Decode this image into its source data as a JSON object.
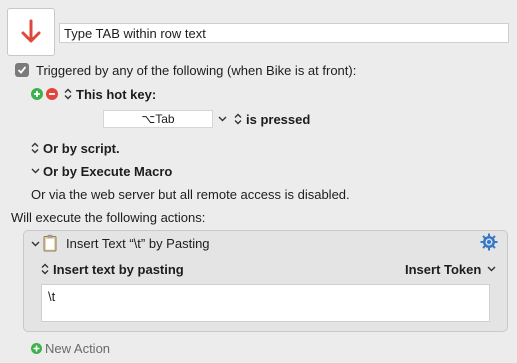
{
  "macro": {
    "name": "Type TAB within row text",
    "icon": "red-down-arrow-icon"
  },
  "trigger": {
    "checked": true,
    "label": "Triggered by any of the following (when Bike is at front):",
    "hotkey_label": "This hot key:",
    "hotkey_value": "⌥Tab",
    "pressed_label": "is pressed",
    "or_by_script": "Or by script.",
    "or_by_execute_macro": "Or by Execute Macro",
    "web_server_note": "Or via the web server but all remote access is disabled."
  },
  "actions_header": "Will execute the following actions:",
  "action": {
    "title": "Insert Text “\\t” by Pasting",
    "mode_label": "Insert text by pasting",
    "token_menu": "Insert Token",
    "text_value": "\\t"
  },
  "new_action_label": "New Action",
  "colors": {
    "accent_red": "#e0463b",
    "accent_green": "#3fb14b",
    "gear_blue": "#3a78c2"
  }
}
